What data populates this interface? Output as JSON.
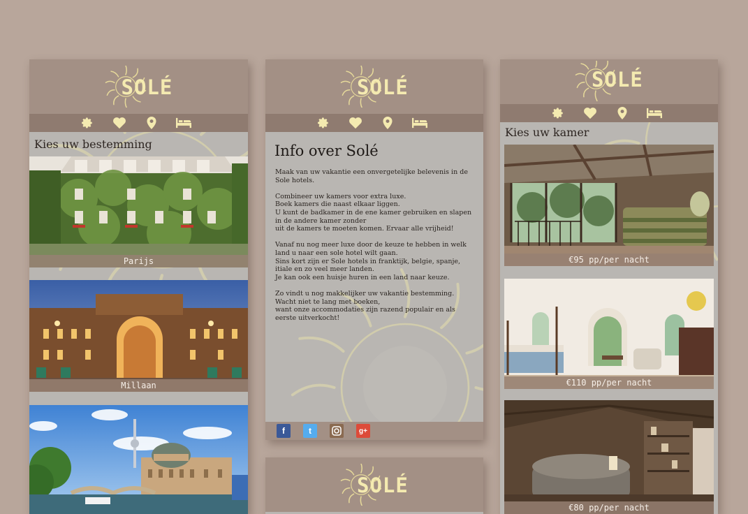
{
  "brand": {
    "name": "SOLÉ",
    "logo_color": "#f4eab0"
  },
  "colors": {
    "background": "#b8a69b",
    "header": "#a39085",
    "nav": "#8f7b70",
    "panel": "#b9b6b2"
  },
  "nav_icons": [
    "gear-icon",
    "heart-icon",
    "location-pin-icon",
    "bed-icon"
  ],
  "destinations": {
    "title": "Kies uw bestemming",
    "items": [
      {
        "caption": "Parijs"
      },
      {
        "caption": "Millaan"
      },
      {
        "caption": ""
      }
    ]
  },
  "info": {
    "title": "Info over Solé",
    "paragraphs": [
      "Maak van uw vakantie een onvergetelijke belevenis in de Sole hotels.",
      "Combineer uw kamers voor extra luxe.\nBoek kamers die naast elkaar liggen.\nU kunt de badkamer in de ene kamer gebruiken en slapen in de andere kamer zonder\nuit de kamers te moeten komen. Ervaar alle vrijheid!",
      "Vanaf nu nog meer luxe door de keuze te hebben in welk land u naar een sole hotel wilt gaan.\nSins kort zijn er Sole hotels in franktijk, belgie, spanje, itiale en zo veel meer landen.\nJe kan ook een huisje huren in een land naar keuze.",
      "Zo vindt u nog makkelijker uw vakantie bestemming.\nWacht niet te lang met boeken,\nwant onze accommodaties zijn razend populair en als eerste uitverkocht!"
    ],
    "social": [
      "facebook-icon",
      "twitter-icon",
      "instagram-icon",
      "google-plus-icon"
    ]
  },
  "rooms": {
    "title": "Kies uw kamer",
    "items": [
      {
        "price": "€95 pp/per nacht"
      },
      {
        "price": "€110 pp/per nacht"
      },
      {
        "price": "€80 pp/per nacht"
      }
    ]
  }
}
